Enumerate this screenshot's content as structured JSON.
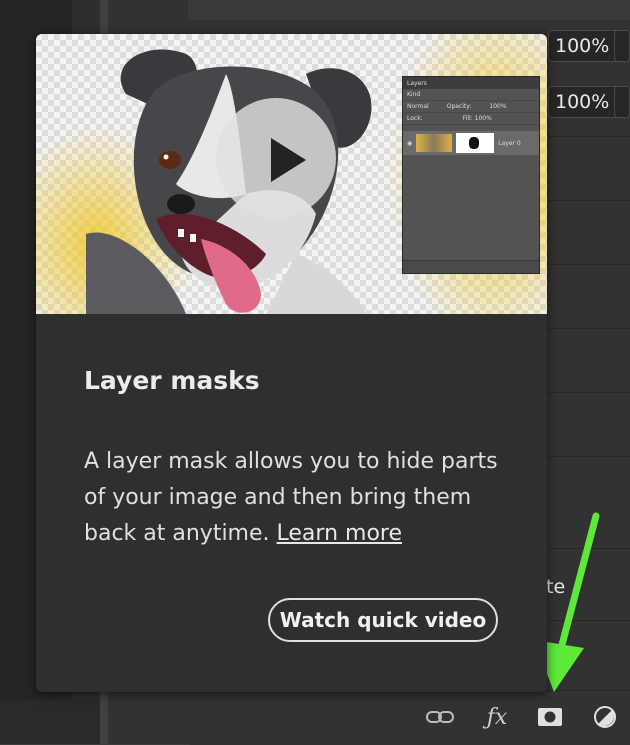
{
  "popup": {
    "title": "Layer masks",
    "body": "A layer mask allows you to hide parts of your image and then bring them back at anytime.",
    "learn_more": "Learn more",
    "watch_button": "Watch quick video"
  },
  "mini_panel": {
    "title": "Layers",
    "kind": "Kind",
    "blend": "Normal",
    "opacity_label": "Opacity:",
    "opacity_value": "100%",
    "lock_label": "Lock:",
    "fill_label": "Fill:",
    "fill_value": "100%",
    "layer_name": "Layer 0"
  },
  "properties": {
    "opacity": "100%",
    "fill": "100%",
    "partial_label": "te"
  },
  "colors": {
    "accent_arrow": "#5de83a",
    "popup_bg": "#2f2f2f"
  },
  "toolbar_icons": [
    "link-icon",
    "fx-icon",
    "layer-mask-icon",
    "adjustment-layer-icon"
  ]
}
